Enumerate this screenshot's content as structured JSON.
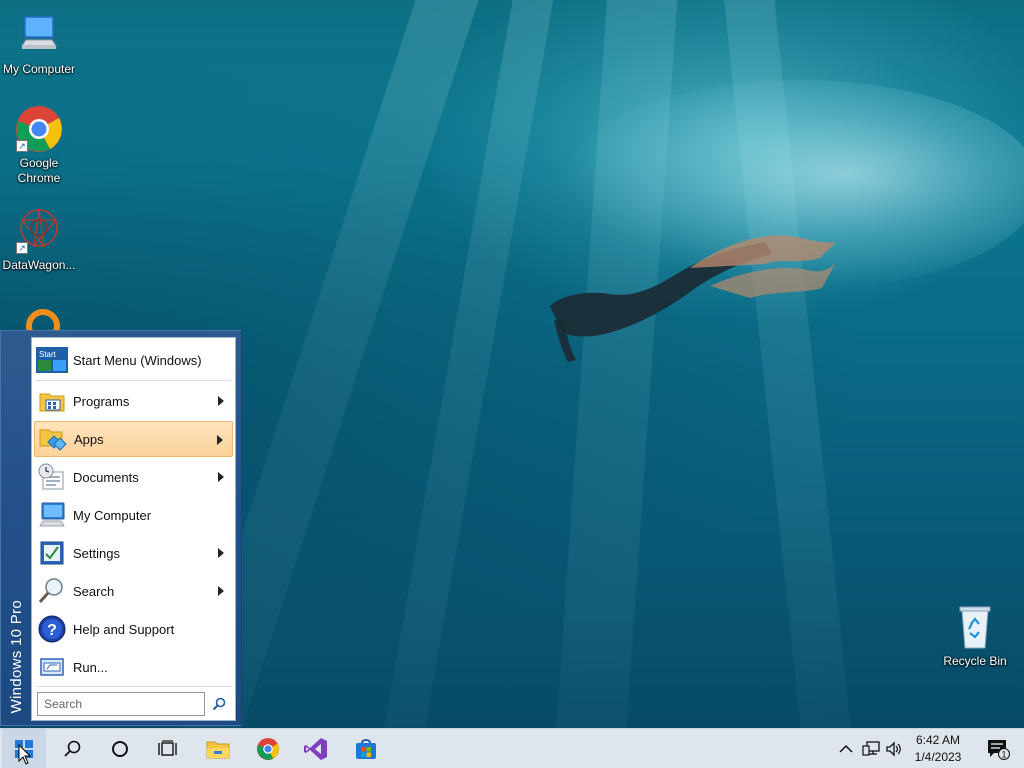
{
  "desktop": {
    "icons": [
      {
        "label": "My Computer"
      },
      {
        "label": "Google Chrome"
      },
      {
        "label": "DataWagon..."
      },
      {
        "label": "Recycle Bin"
      }
    ]
  },
  "start_menu": {
    "banner": "Windows 10 Pro",
    "header_label": "Start Menu (Windows)",
    "header_icon_text": "Start",
    "items": [
      {
        "label": "Programs",
        "icon": "programs-icon",
        "submenu": true
      },
      {
        "label": "Apps",
        "icon": "apps-icon",
        "submenu": true,
        "highlighted": true
      },
      {
        "label": "Documents",
        "icon": "documents-icon",
        "submenu": true
      },
      {
        "label": "My Computer",
        "icon": "computer-icon",
        "submenu": false
      },
      {
        "label": "Settings",
        "icon": "settings-icon",
        "submenu": true
      },
      {
        "label": "Search",
        "icon": "search-icon",
        "submenu": true
      },
      {
        "label": "Help and Support",
        "icon": "help-icon",
        "submenu": false
      },
      {
        "label": "Run...",
        "icon": "run-icon",
        "submenu": false
      }
    ],
    "search_placeholder": "Search"
  },
  "taskbar": {
    "pinned": [
      "search-icon",
      "cortana-icon",
      "task-view-icon",
      "file-explorer-icon",
      "chrome-icon",
      "visual-studio-icon",
      "store-icon"
    ],
    "clock": {
      "time": "6:42 AM",
      "date": "1/4/2023"
    },
    "notification_count": "1"
  },
  "colors": {
    "menu_blue": "#23508a",
    "highlight": "#fcd29a",
    "taskbar": "#dfe5ec"
  }
}
